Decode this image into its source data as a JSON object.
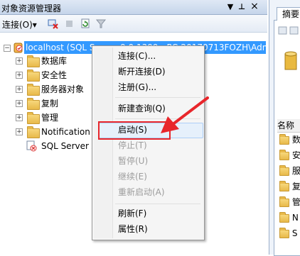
{
  "explorer": {
    "title": "对象资源管理器",
    "pin_glyph": "▼",
    "dock_glyph": "ㅁ",
    "close_glyph": "×",
    "toolbar": {
      "connect_label": "连接(O)▾"
    }
  },
  "tree": {
    "root_label": "localhost (SQL Server 9.0.1399 - PC-20170713FOZH\\Adm",
    "items": [
      {
        "label": "数据库"
      },
      {
        "label": "安全性"
      },
      {
        "label": "服务器对象"
      },
      {
        "label": "复制"
      },
      {
        "label": "管理"
      },
      {
        "label": "Notification Services"
      },
      {
        "label": "SQL Server Agent"
      }
    ]
  },
  "context_menu": {
    "items": [
      {
        "label": "连接(C)...",
        "enabled": true
      },
      {
        "label": "断开连接(D)",
        "enabled": true
      },
      {
        "label": "注册(G)...",
        "enabled": true
      },
      {
        "label": "新建查询(Q)",
        "enabled": true
      },
      {
        "label": "启动(S)",
        "enabled": true,
        "highlighted": true
      },
      {
        "label": "停止(T)",
        "enabled": false
      },
      {
        "label": "暂停(U)",
        "enabled": false
      },
      {
        "label": "继续(E)",
        "enabled": false
      },
      {
        "label": "重新启动(A)",
        "enabled": false
      },
      {
        "label": "刷新(F)",
        "enabled": true
      },
      {
        "label": "属性(R)",
        "enabled": true
      }
    ]
  },
  "right_panel": {
    "tab_label": "摘要",
    "list_header": "名称",
    "items": [
      "数",
      "安",
      "服",
      "复",
      "管",
      "N",
      "S"
    ]
  },
  "colors": {
    "selection": "#3399ff",
    "annotation_red": "#e8262b"
  }
}
